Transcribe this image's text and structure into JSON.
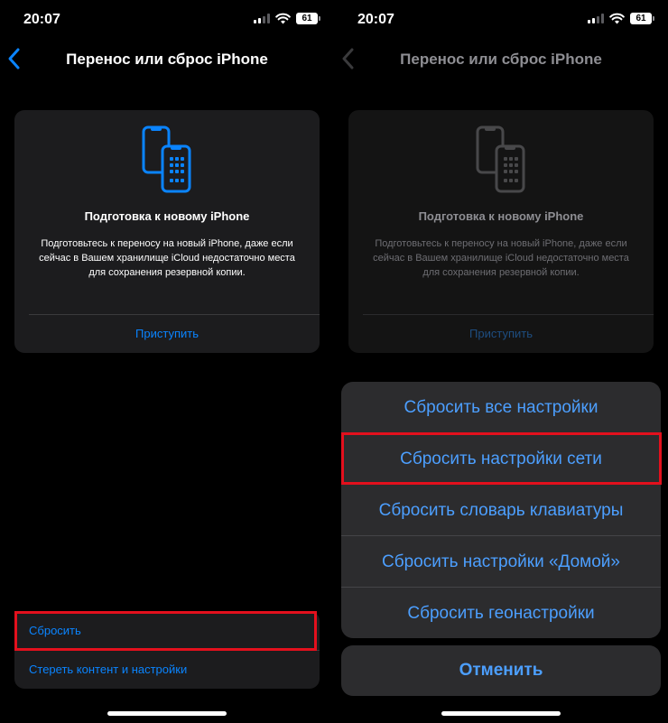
{
  "status": {
    "time": "20:07",
    "battery": "61"
  },
  "nav": {
    "title": "Перенос или сброс iPhone"
  },
  "card": {
    "title": "Подготовка к новому iPhone",
    "description": "Подготовьтесь к переносу на новый iPhone, даже если сейчас в Вашем хранилище iCloud недостаточно места для сохранения резервной копии.",
    "action": "Приступить"
  },
  "bottom_list": {
    "reset": "Сбросить",
    "erase": "Стереть контент и настройки"
  },
  "action_sheet": {
    "items": [
      "Сбросить все настройки",
      "Сбросить настройки сети",
      "Сбросить словарь клавиатуры",
      "Сбросить настройки «Домой»",
      "Сбросить геонастройки"
    ],
    "cancel": "Отменить"
  },
  "colors": {
    "accent": "#0a84ff",
    "highlight": "#e3101d",
    "background": "#000000",
    "card": "#1c1c1e"
  },
  "icons": [
    "back-chevron-icon",
    "phones-transfer-icon",
    "signal-icon",
    "wifi-icon",
    "battery-icon"
  ]
}
